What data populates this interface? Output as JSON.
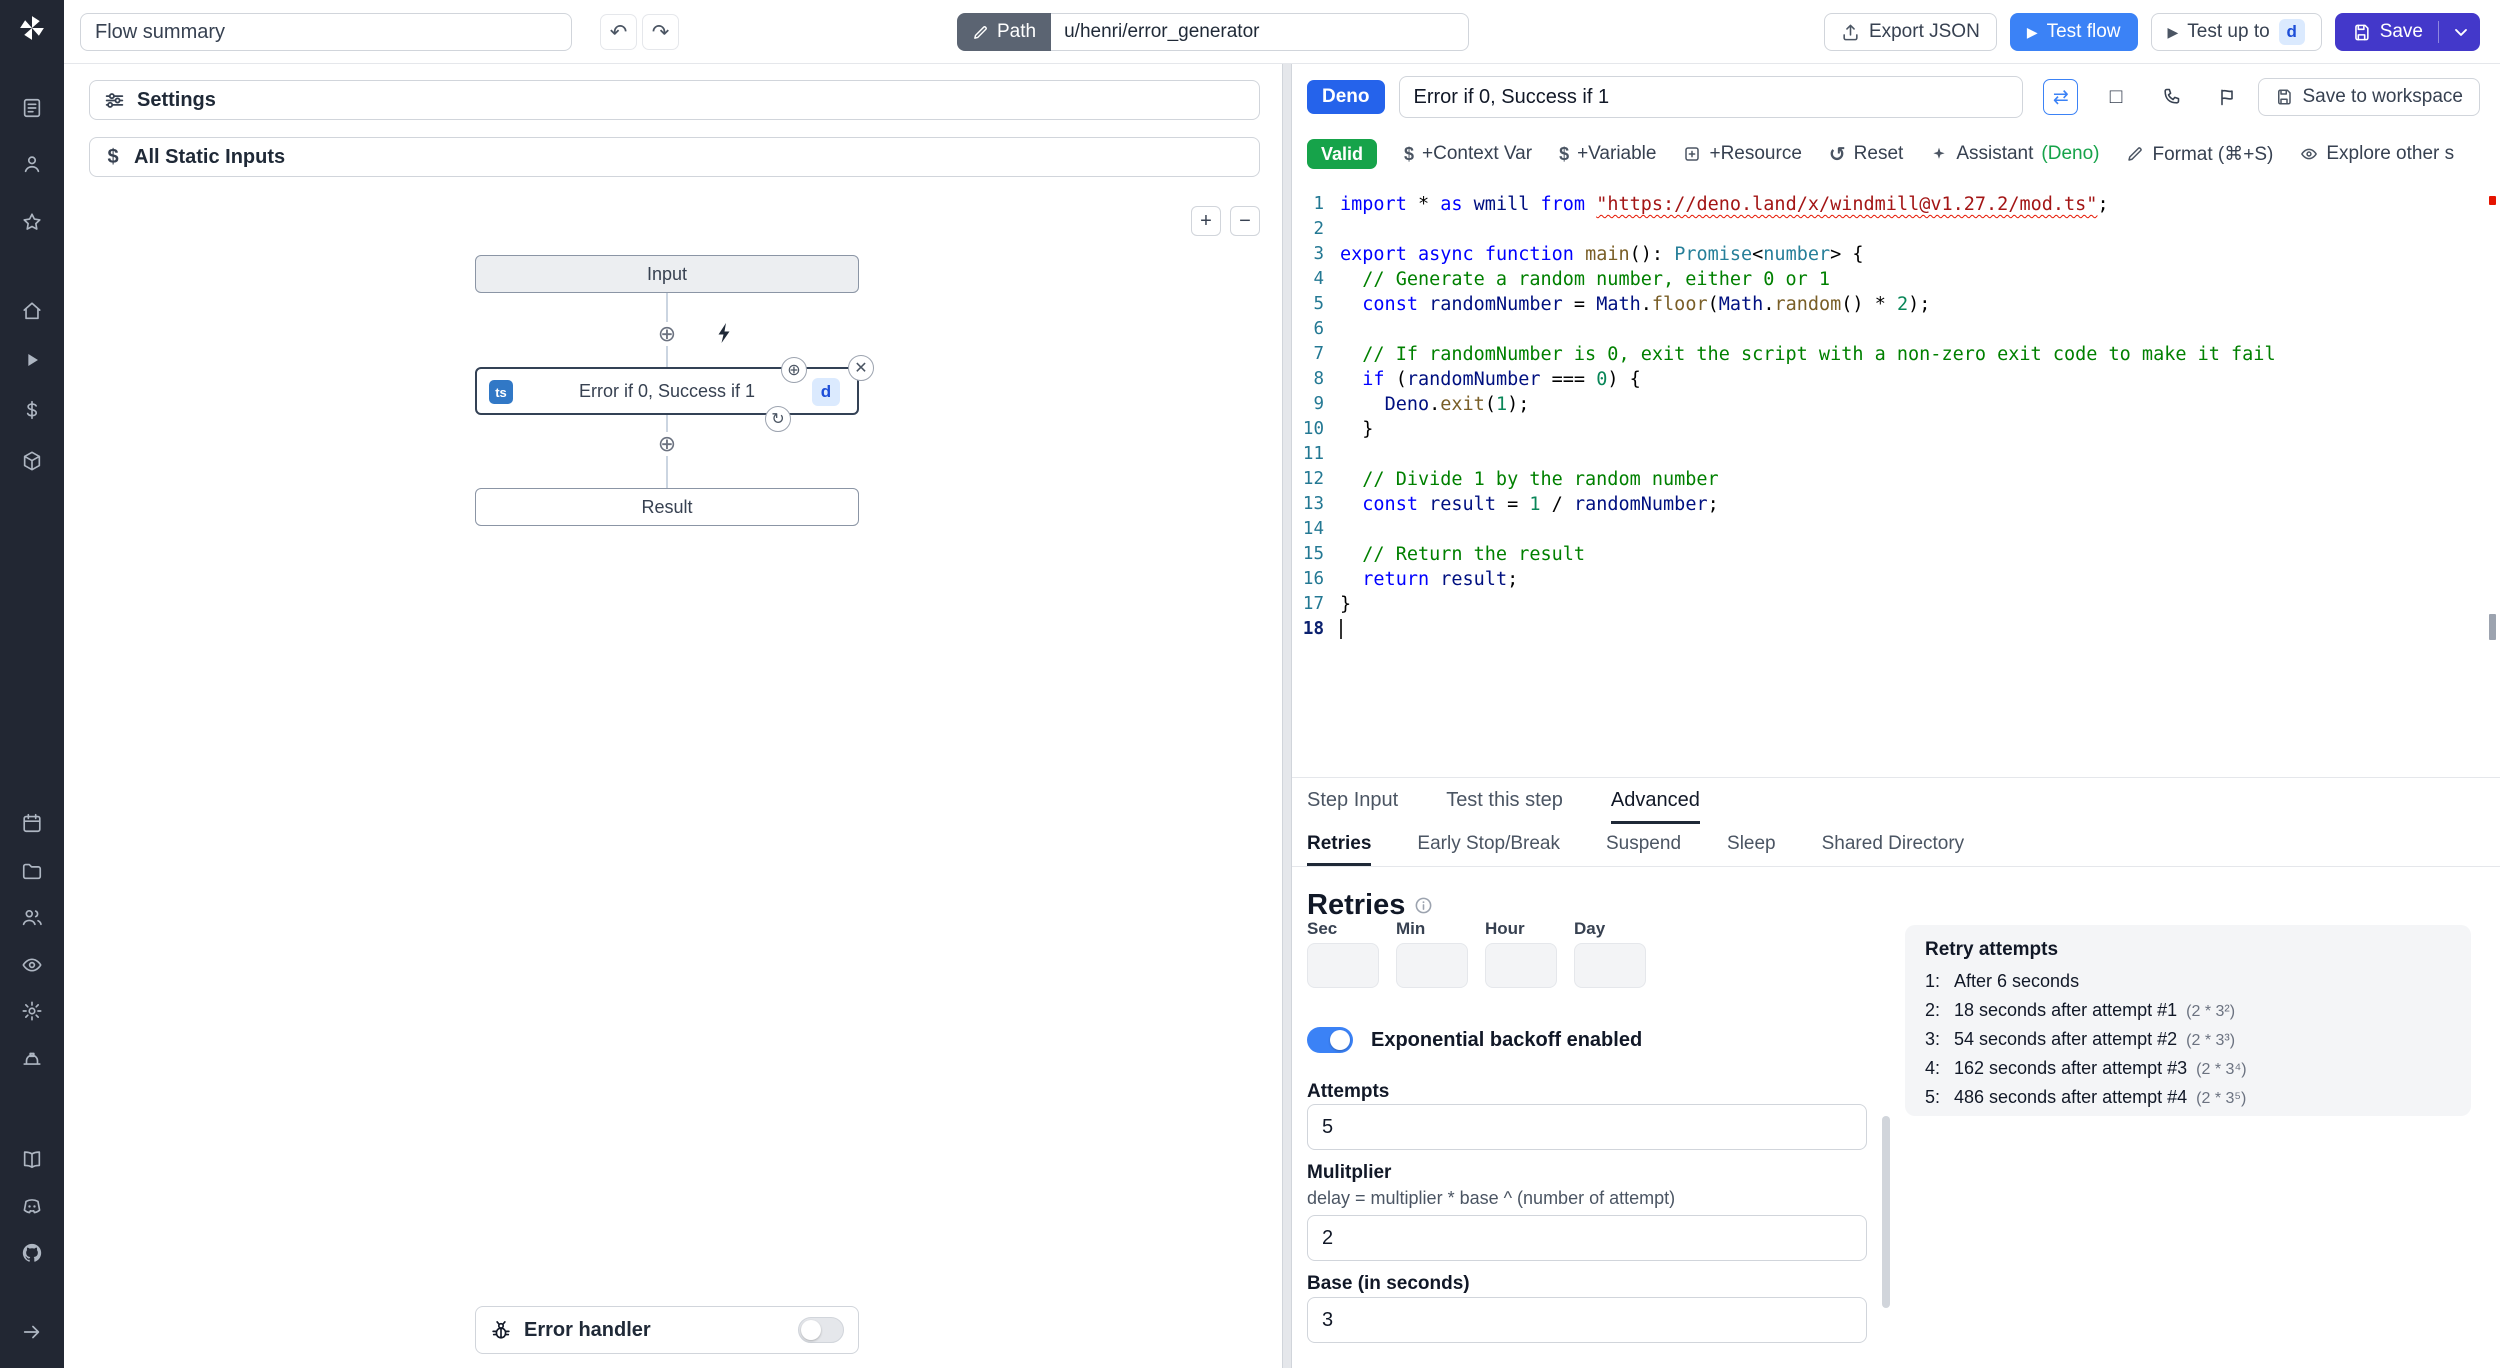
{
  "topbar": {
    "flow_summary": "Flow summary",
    "path_label": "Path",
    "path_value": "u/henri/error_generator",
    "export_json": "Export JSON",
    "test_flow": "Test flow",
    "test_up_to": "Test up to",
    "test_up_to_badge": "d",
    "save": "Save"
  },
  "sidebar": {
    "icons": [
      "document",
      "user",
      "star",
      "home",
      "play",
      "dollar",
      "cube",
      "calendar",
      "folder",
      "users",
      "eye",
      "gear",
      "hard-hat",
      "book",
      "discord",
      "github",
      "arrow-right"
    ]
  },
  "flow": {
    "settings_label": "Settings",
    "static_inputs_label": "All Static Inputs",
    "zoom_in": "+",
    "zoom_out": "−",
    "input_node": "Input",
    "step_node": {
      "lang": "ts",
      "title": "Error if 0, Success if 1",
      "id_badge": "d"
    },
    "result_node": "Result",
    "error_handler_label": "Error handler"
  },
  "editor": {
    "lang_badge": "Deno",
    "title": "Error if 0, Success if 1",
    "save_to_workspace": "Save to workspace",
    "toolbar": {
      "valid": "Valid",
      "items": [
        {
          "icon": "dollar",
          "label": "+Context Var"
        },
        {
          "icon": "dollar",
          "label": "+Variable"
        },
        {
          "icon": "plus-box",
          "label": "+Resource"
        },
        {
          "icon": "reset",
          "label": "Reset"
        },
        {
          "icon": "assistant",
          "label": "Assistant",
          "suffix": "(Deno)"
        },
        {
          "icon": "format",
          "label": "Format (⌘+S)"
        },
        {
          "icon": "explore-eye",
          "label": "Explore other s"
        }
      ]
    },
    "code": {
      "lines": [
        [
          [
            "k",
            "import"
          ],
          [
            "d",
            " * "
          ],
          [
            "k",
            "as"
          ],
          [
            "d",
            " "
          ],
          [
            "v",
            "wmill"
          ],
          [
            "d",
            " "
          ],
          [
            "k",
            "from"
          ],
          [
            "d",
            " "
          ],
          [
            "sq",
            "\"https://deno.land/x/windmill@v1.27.2/mod.ts\""
          ],
          [
            "d",
            ";"
          ]
        ],
        [],
        [
          [
            "k",
            "export"
          ],
          [
            "d",
            " "
          ],
          [
            "k",
            "async"
          ],
          [
            "d",
            " "
          ],
          [
            "k",
            "function"
          ],
          [
            "d",
            " "
          ],
          [
            "f",
            "main"
          ],
          [
            "d",
            "(): "
          ],
          [
            "t",
            "Promise"
          ],
          [
            "d",
            "<"
          ],
          [
            "t",
            "number"
          ],
          [
            "d",
            "> {"
          ]
        ],
        [
          [
            "c",
            "  // Generate a random number, either 0 or 1"
          ]
        ],
        [
          [
            "d",
            "  "
          ],
          [
            "k",
            "const"
          ],
          [
            "d",
            " "
          ],
          [
            "v",
            "randomNumber"
          ],
          [
            "d",
            " = "
          ],
          [
            "v",
            "Math"
          ],
          [
            "d",
            "."
          ],
          [
            "f",
            "floor"
          ],
          [
            "d",
            "("
          ],
          [
            "v",
            "Math"
          ],
          [
            "d",
            "."
          ],
          [
            "f",
            "random"
          ],
          [
            "d",
            "() * "
          ],
          [
            "n",
            "2"
          ],
          [
            "d",
            ");"
          ]
        ],
        [],
        [
          [
            "c",
            "  // If randomNumber is 0, exit the script with a non-zero exit code to make it fail"
          ]
        ],
        [
          [
            "d",
            "  "
          ],
          [
            "k",
            "if"
          ],
          [
            "d",
            " ("
          ],
          [
            "v",
            "randomNumber"
          ],
          [
            "d",
            " === "
          ],
          [
            "n",
            "0"
          ],
          [
            "d",
            ") {"
          ]
        ],
        [
          [
            "d",
            "    "
          ],
          [
            "v",
            "Deno"
          ],
          [
            "d",
            "."
          ],
          [
            "f",
            "exit"
          ],
          [
            "d",
            "("
          ],
          [
            "n",
            "1"
          ],
          [
            "d",
            ");"
          ]
        ],
        [
          [
            "d",
            "  }"
          ]
        ],
        [],
        [
          [
            "c",
            "  // Divide 1 by the random number"
          ]
        ],
        [
          [
            "d",
            "  "
          ],
          [
            "k",
            "const"
          ],
          [
            "d",
            " "
          ],
          [
            "v",
            "result"
          ],
          [
            "d",
            " = "
          ],
          [
            "n",
            "1"
          ],
          [
            "d",
            " / "
          ],
          [
            "v",
            "randomNumber"
          ],
          [
            "d",
            ";"
          ]
        ],
        [],
        [
          [
            "c",
            "  // Return the result"
          ]
        ],
        [
          [
            "d",
            "  "
          ],
          [
            "k",
            "return"
          ],
          [
            "d",
            " "
          ],
          [
            "v",
            "result"
          ],
          [
            "d",
            ";"
          ]
        ],
        [
          [
            "d",
            "}"
          ]
        ],
        []
      ]
    }
  },
  "panel": {
    "tabs": [
      "Step Input",
      "Test this step",
      "Advanced"
    ],
    "active_tab": 2,
    "subtabs": [
      "Retries",
      "Early Stop/Break",
      "Suspend",
      "Sleep",
      "Shared Directory"
    ],
    "active_subtab": 0,
    "retries": {
      "title": "Retries",
      "time_fields": [
        "Sec",
        "Min",
        "Hour",
        "Day"
      ],
      "backoff_label": "Exponential backoff enabled",
      "attempts_label": "Attempts",
      "attempts_value": "5",
      "multiplier_label": "Mulitplier",
      "multiplier_help": "delay = multiplier * base ^ (number of attempt)",
      "multiplier_value": "2",
      "base_label": "Base (in seconds)",
      "base_value": "3",
      "retry_box": {
        "title": "Retry attempts",
        "items": [
          {
            "n": "1:",
            "text": "After 6 seconds",
            "formula": ""
          },
          {
            "n": "2:",
            "text": "18 seconds after attempt #1",
            "formula": "(2 * 3²)"
          },
          {
            "n": "3:",
            "text": "54 seconds after attempt #2",
            "formula": "(2 * 3³)"
          },
          {
            "n": "4:",
            "text": "162 seconds after attempt #3",
            "formula": "(2 * 3⁴)"
          },
          {
            "n": "5:",
            "text": "486 seconds after attempt #4",
            "formula": "(2 * 3⁵)"
          }
        ]
      }
    }
  },
  "colors": {
    "accent_blue": "#3b82f6",
    "save_indigo": "#4338ca",
    "valid_green": "#16a34a",
    "deno_badge_blue": "#2563eb",
    "sidebar_dark": "#222733"
  }
}
